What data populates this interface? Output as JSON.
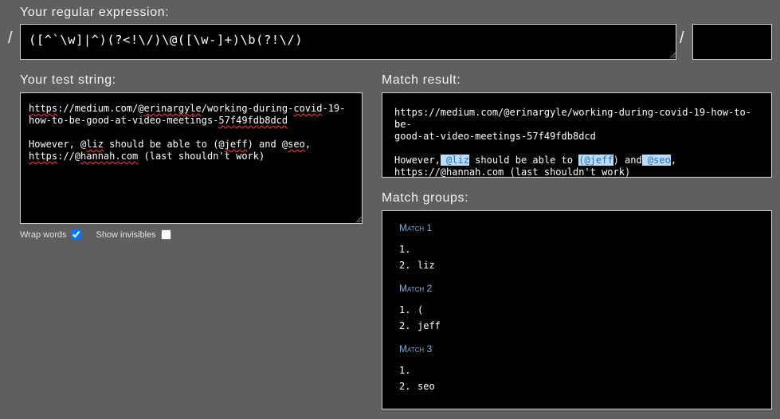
{
  "labels": {
    "regex": "Your regular expression:",
    "test": "Your test string:",
    "result": "Match result:",
    "groups": "Match groups:"
  },
  "regex": {
    "delimiter": "/",
    "value": "([^`\\w]|^)(?<!\\/)\\@([\\w-]+)\\b(?!\\/)",
    "flags": ""
  },
  "test_string": {
    "line1_parts": [
      "https",
      "://medium.com/@",
      "erinargyle",
      "/working-during-",
      "covid",
      "-19-"
    ],
    "line2_parts": [
      "how-to-be-good-at-video-meetings-",
      "57f49fdb8dcd"
    ],
    "line3_parts": [
      "However, @",
      "liz",
      " should be able to (@",
      "jeff",
      ") and @",
      "seo",
      ","
    ],
    "line4_parts": [
      "https",
      "://@",
      "hannah.com",
      " (last shouldn't work)"
    ]
  },
  "options": {
    "wrap_words": "Wrap words",
    "wrap_checked": true,
    "show_invisibles": "Show invisibles",
    "invisibles_checked": false
  },
  "match_result": {
    "line1": "https://medium.com/@erinargyle/working-during-covid-19-how-to-be-",
    "line2": "good-at-video-meetings-57f49fdb8dcd",
    "line3_parts": [
      "However,",
      " @liz",
      " should be able to ",
      "(@jeff",
      ") and",
      " @seo",
      ","
    ],
    "line4": "https://@hannah.com (last shouldn't work)"
  },
  "groups": [
    {
      "title": "Match 1",
      "items": [
        {
          "n": "1.",
          "v": ""
        },
        {
          "n": "2.",
          "v": "liz"
        }
      ]
    },
    {
      "title": "Match 2",
      "items": [
        {
          "n": "1.",
          "v": "("
        },
        {
          "n": "2.",
          "v": "jeff"
        }
      ]
    },
    {
      "title": "Match 3",
      "items": [
        {
          "n": "1.",
          "v": ""
        },
        {
          "n": "2.",
          "v": "seo"
        }
      ]
    }
  ],
  "colors": {
    "background": "#5f5f5f",
    "highlight": "#b9dcff",
    "group_title": "#7fb0e8"
  }
}
